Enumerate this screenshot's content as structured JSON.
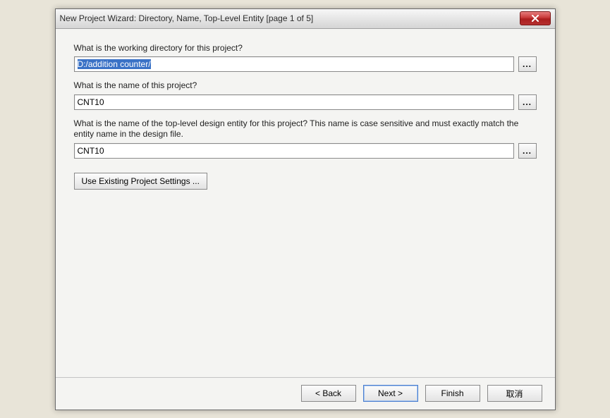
{
  "window": {
    "title": "New Project Wizard: Directory, Name, Top-Level Entity [page 1 of 5]"
  },
  "labels": {
    "working_dir": "What is the working directory for this project?",
    "project_name": "What is the name of this project?",
    "top_entity": "What is the name of the top-level design entity for this project? This name is case sensitive and must exactly match the entity name in the design file."
  },
  "values": {
    "working_dir": "D:/addition counter/",
    "project_name": "CNT10",
    "top_entity": "CNT10"
  },
  "buttons": {
    "browse": "...",
    "use_existing": "Use Existing Project Settings ...",
    "back": "< Back",
    "next": "Next >",
    "finish": "Finish",
    "cancel": "取消"
  }
}
